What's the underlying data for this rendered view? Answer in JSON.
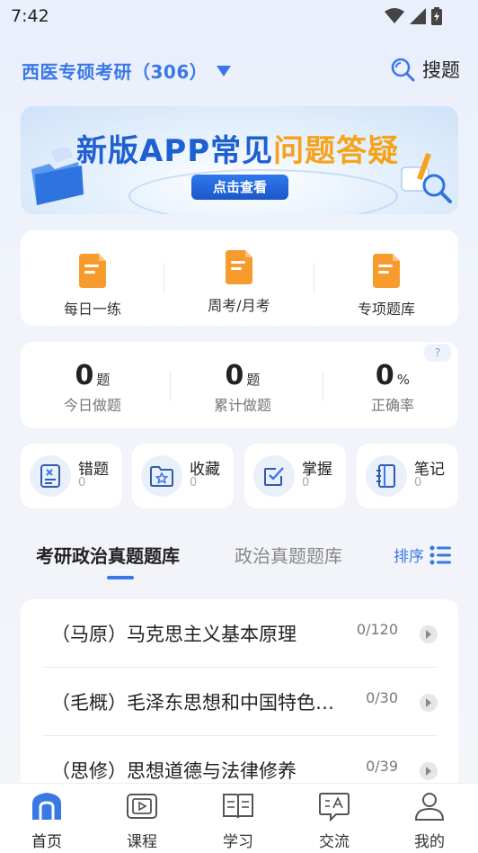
{
  "status_bar": {
    "time": "7:42"
  },
  "header": {
    "exam_name": "西医专硕考研（306）",
    "search_label": "搜题"
  },
  "banner": {
    "title_part1": "新版APP常见",
    "title_part2": "问题答疑",
    "cta": "点击查看"
  },
  "practice": {
    "items": [
      {
        "label": "每日一练",
        "icon": "document-icon"
      },
      {
        "label": "周考/月考",
        "icon": "document-icon"
      },
      {
        "label": "专项题库",
        "icon": "document-icon"
      }
    ]
  },
  "stats": {
    "help": "?",
    "items": [
      {
        "value": "0",
        "unit": "题",
        "label": "今日做题"
      },
      {
        "value": "0",
        "unit": "题",
        "label": "累计做题"
      },
      {
        "value": "0",
        "unit": "%",
        "label": "正确率"
      }
    ]
  },
  "quick": [
    {
      "name": "错题",
      "count": "0",
      "icon": "wrong-answer-icon"
    },
    {
      "name": "收藏",
      "count": "0",
      "icon": "star-folder-icon"
    },
    {
      "name": "掌握",
      "count": "0",
      "icon": "checkbox-icon"
    },
    {
      "name": "笔记",
      "count": "0",
      "icon": "notebook-icon"
    }
  ],
  "tabs": {
    "active": "考研政治真题题库",
    "inactive": "政治真题题库",
    "sort_label": "排序"
  },
  "list": [
    {
      "title": "（马原）马克思主义基本原理",
      "progress": "0/120"
    },
    {
      "title": "（毛概）毛泽东思想和中国特色社会主义理论体系概论",
      "progress": "0/30"
    },
    {
      "title": "（思修）思想道德与法律修养",
      "progress": "0/39"
    }
  ],
  "nav": [
    {
      "label": "首页",
      "icon": "home-icon"
    },
    {
      "label": "课程",
      "icon": "course-video-icon"
    },
    {
      "label": "学习",
      "icon": "book-icon"
    },
    {
      "label": "交流",
      "icon": "chat-icon"
    },
    {
      "label": "我的",
      "icon": "profile-icon"
    }
  ],
  "colors": {
    "accent": "#3b78e7",
    "orange": "#f6a21a",
    "background": "#f1f4fa"
  }
}
